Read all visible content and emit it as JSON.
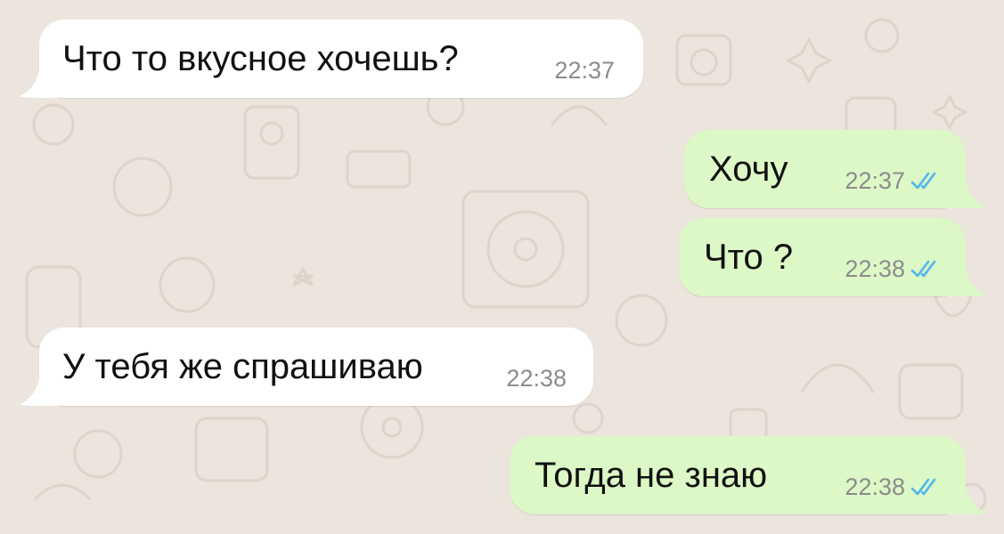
{
  "chat": {
    "messages": [
      {
        "direction": "incoming",
        "text": "Что то вкусное хочешь?",
        "time": "22:37",
        "status_icon": ""
      },
      {
        "direction": "outgoing",
        "text": "Хочу",
        "time": "22:37",
        "status_icon": "double-check-read-icon"
      },
      {
        "direction": "outgoing",
        "text": "Что ?",
        "time": "22:38",
        "status_icon": "double-check-read-icon"
      },
      {
        "direction": "incoming",
        "text": "У тебя же спрашиваю",
        "time": "22:38",
        "status_icon": ""
      },
      {
        "direction": "outgoing",
        "text": "Тогда не знаю",
        "time": "22:38",
        "status_icon": "double-check-read-icon"
      }
    ]
  },
  "colors": {
    "wallpaper": "#ece5dd",
    "incoming_bubble": "#ffffff",
    "outgoing_bubble": "#dcf8c6",
    "read_ticks": "#4fb6ec",
    "timestamp": "#8c8c8c"
  }
}
